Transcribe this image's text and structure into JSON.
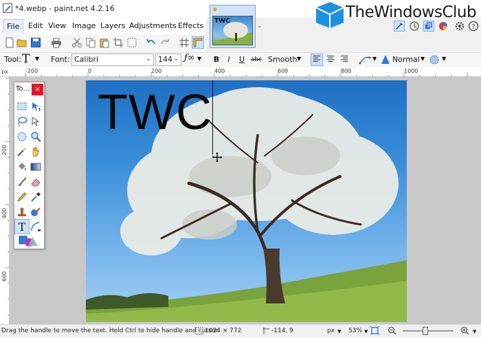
{
  "window": {
    "title": "*4.webp - paint.net 4.2.16"
  },
  "menu": {
    "items": [
      "File",
      "Edit",
      "View",
      "Image",
      "Layers",
      "Adjustments",
      "Effects"
    ]
  },
  "thumbnail": {
    "label": "TWC"
  },
  "watermark": {
    "text": "TheWindowsClub"
  },
  "text_toolbar": {
    "tool_label": "Tool:",
    "font_label": "Font:",
    "font_value": "Calibri",
    "size_value": "144",
    "bold": "B",
    "italic": "I",
    "underline": "U",
    "strike": "abc",
    "antialias": "Smooth",
    "blend_mode": "Normal"
  },
  "ruler": {
    "unit": "px",
    "top_ticks": [
      "-200",
      "0",
      "200",
      "400",
      "600",
      "800",
      "1000"
    ],
    "left_ticks": [
      "200",
      "400",
      "600"
    ]
  },
  "canvas": {
    "overlay_text": "TWC"
  },
  "tools_window": {
    "title": "To...",
    "close": "×"
  },
  "status": {
    "hint": "Drag the handle to move the text. Hold Ctrl to hide handle and cursor.",
    "image_size": "1024 × 772",
    "cursor_pos": "-114, 9",
    "units": "px",
    "zoom": "53%"
  },
  "colors": {
    "accent": "#2f7bd8",
    "close": "#e81123",
    "logo": "#1e90e0"
  }
}
